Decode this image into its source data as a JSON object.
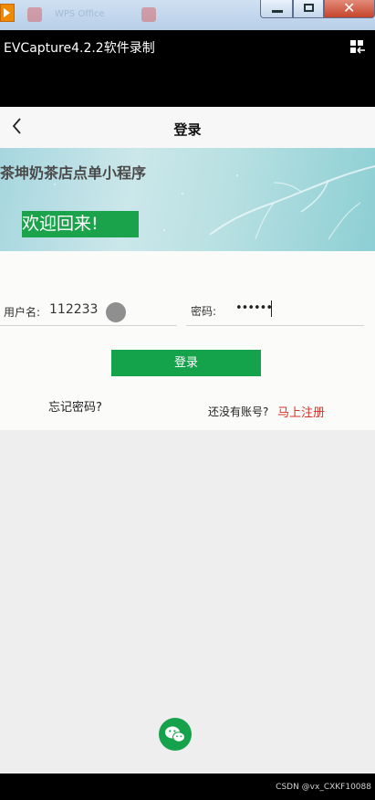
{
  "window": {
    "faint_text": "WPS Office",
    "app_title": "EVCapture4.2.2软件录制"
  },
  "nav": {
    "title": "登录"
  },
  "banner": {
    "shop_name": "茶坤奶茶店点单小程序",
    "welcome": "欢迎回来!"
  },
  "form": {
    "username_label": "用户名:",
    "username_value": "112233",
    "password_label": "密码:",
    "password_value": "••••••",
    "login_button": "登录",
    "forgot_password": "忘记密码?",
    "no_account": "还没有账号?",
    "register_link": "马上注册"
  },
  "icons": {
    "back": "chevron-left-icon",
    "wechat": "wechat-icon",
    "app_menu": "layout-icon"
  },
  "colors": {
    "primary_green": "#14a34b",
    "link_red": "#d93025"
  },
  "watermark": "CSDN @vx_CXKF10088"
}
